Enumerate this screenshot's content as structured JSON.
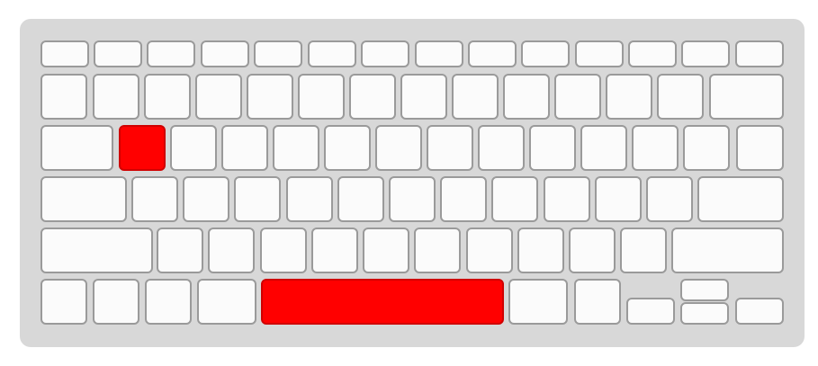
{
  "keyboard": {
    "highlight_color": "#ff0000",
    "highlighted_keys": [
      "row3-key2",
      "space-bar"
    ]
  }
}
